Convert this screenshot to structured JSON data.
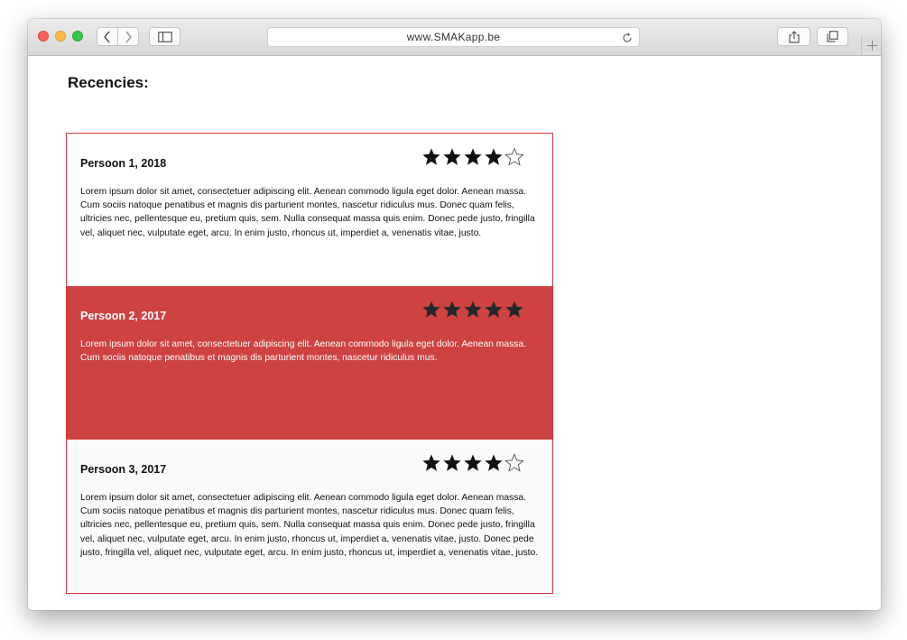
{
  "browser": {
    "url": "www.SMAKapp.be"
  },
  "page": {
    "title": "Recencies:"
  },
  "colors": {
    "accent": "#cf4242",
    "border": "#d43a3a"
  },
  "reviews": [
    {
      "name": "Persoon 1, 2018",
      "rating": 4,
      "max_rating": 5,
      "text": "Lorem ipsum dolor sit amet, consectetuer adipiscing elit. Aenean commodo ligula eget dolor. Aenean massa. Cum sociis natoque penatibus et magnis dis parturient montes, nascetur ridiculus mus. Donec quam felis, ultricies nec, pellentesque eu, pretium quis, sem. Nulla consequat massa quis enim. Donec pede justo, fringilla vel, aliquet nec, vulputate eget, arcu. In enim justo, rhoncus ut, imperdiet a, venenatis vitae, justo."
    },
    {
      "name": "Persoon 2, 2017",
      "rating": 5,
      "max_rating": 5,
      "text": "Lorem ipsum dolor sit amet, consectetuer adipiscing elit. Aenean commodo ligula eget dolor. Aenean massa. Cum sociis natoque penatibus et magnis dis parturient montes, nascetur ridiculus mus."
    },
    {
      "name": "Persoon 3, 2017",
      "rating": 4,
      "max_rating": 5,
      "text": "Lorem ipsum dolor sit amet, consectetuer adipiscing elit. Aenean commodo ligula eget dolor. Aenean massa. Cum sociis natoque penatibus et magnis dis parturient montes, nascetur ridiculus mus. Donec quam felis, ultricies nec, pellentesque eu, pretium quis, sem. Nulla consequat massa quis enim. Donec pede justo, fringilla vel, aliquet nec, vulputate eget, arcu. In enim justo, rhoncus ut, imperdiet a, venenatis vitae, justo. Donec pede justo, fringilla vel, aliquet nec, vulputate eget, arcu. In enim justo, rhoncus ut, imperdiet a, venenatis vitae, justo."
    }
  ]
}
